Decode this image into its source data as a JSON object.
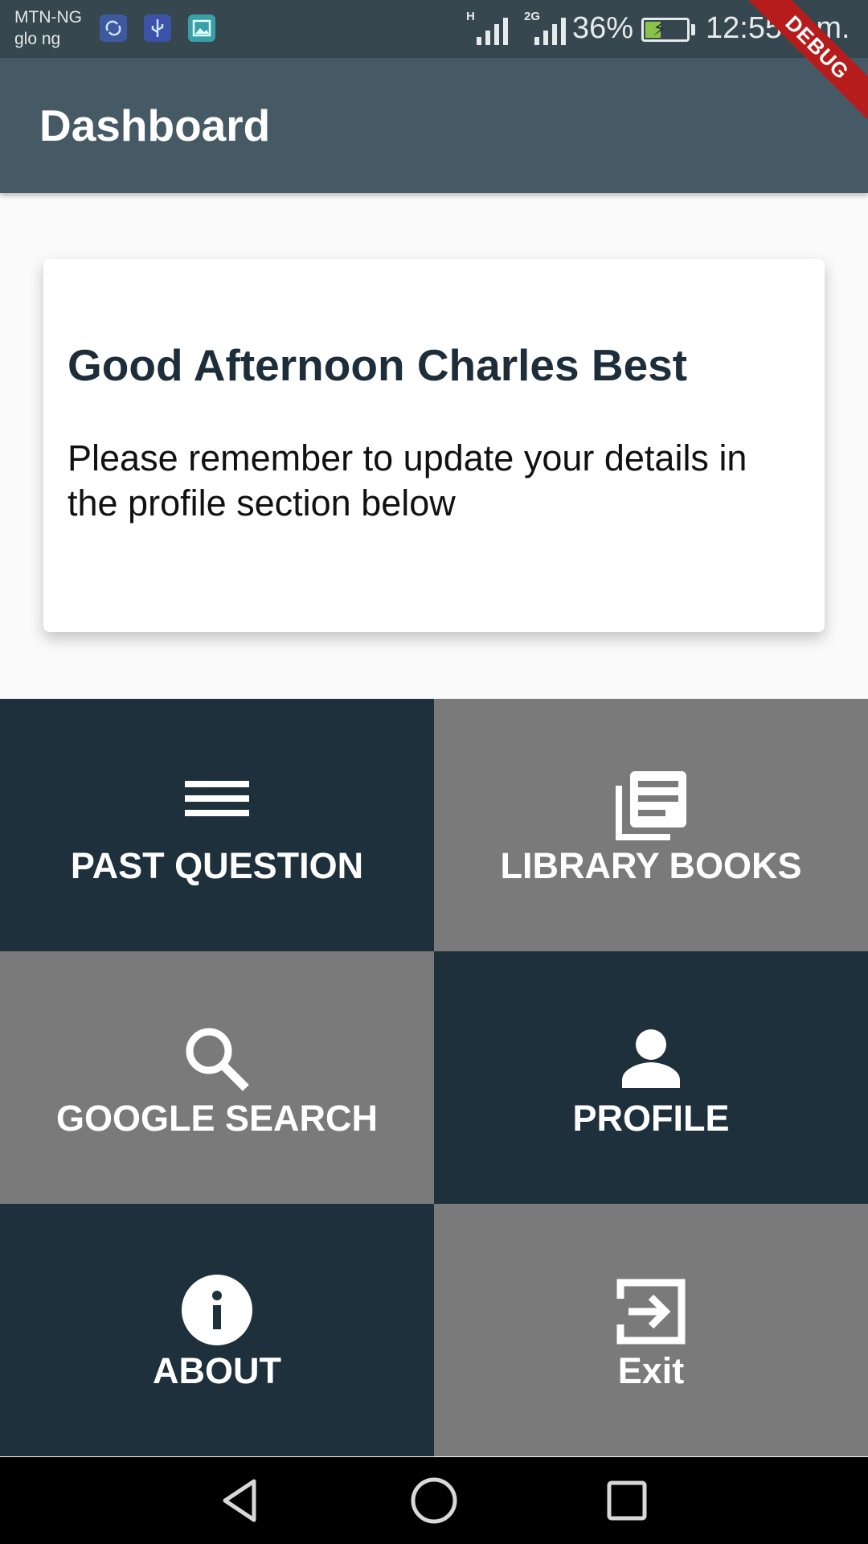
{
  "status_bar": {
    "carrier_1": "MTN-NG",
    "carrier_2": "glo ng",
    "notification_icons": [
      "sync-icon",
      "usb-icon",
      "gallery-icon"
    ],
    "network_tag_1": "H",
    "network_tag_2": "2G",
    "battery_percent": "36%",
    "battery_level": 0.36,
    "time": "12:55 p.m.",
    "debug_banner": "DEBUG"
  },
  "app_bar": {
    "title": "Dashboard"
  },
  "card": {
    "greeting": "Good Afternoon Charles Best",
    "message": "Please remember to update your details in the profile section below"
  },
  "tiles": [
    {
      "label": "PAST QUESTION",
      "icon": "menu-icon",
      "theme": "dark"
    },
    {
      "label": "LIBRARY BOOKS",
      "icon": "library-books-icon",
      "theme": "gray"
    },
    {
      "label": "GOOGLE SEARCH",
      "icon": "search-icon",
      "theme": "gray"
    },
    {
      "label": "PROFILE",
      "icon": "person-icon",
      "theme": "dark"
    },
    {
      "label": "ABOUT",
      "icon": "info-icon",
      "theme": "dark"
    },
    {
      "label": "Exit",
      "icon": "exit-icon",
      "theme": "gray"
    }
  ],
  "colors": {
    "status_bar": "#37474f",
    "app_bar": "#455a64",
    "tile_dark": "#1e303b",
    "tile_gray": "#7a7a7a",
    "debug_ribbon": "#b71c1c"
  },
  "nav_bar": {
    "buttons": [
      "back-icon",
      "home-icon",
      "recents-icon"
    ]
  }
}
